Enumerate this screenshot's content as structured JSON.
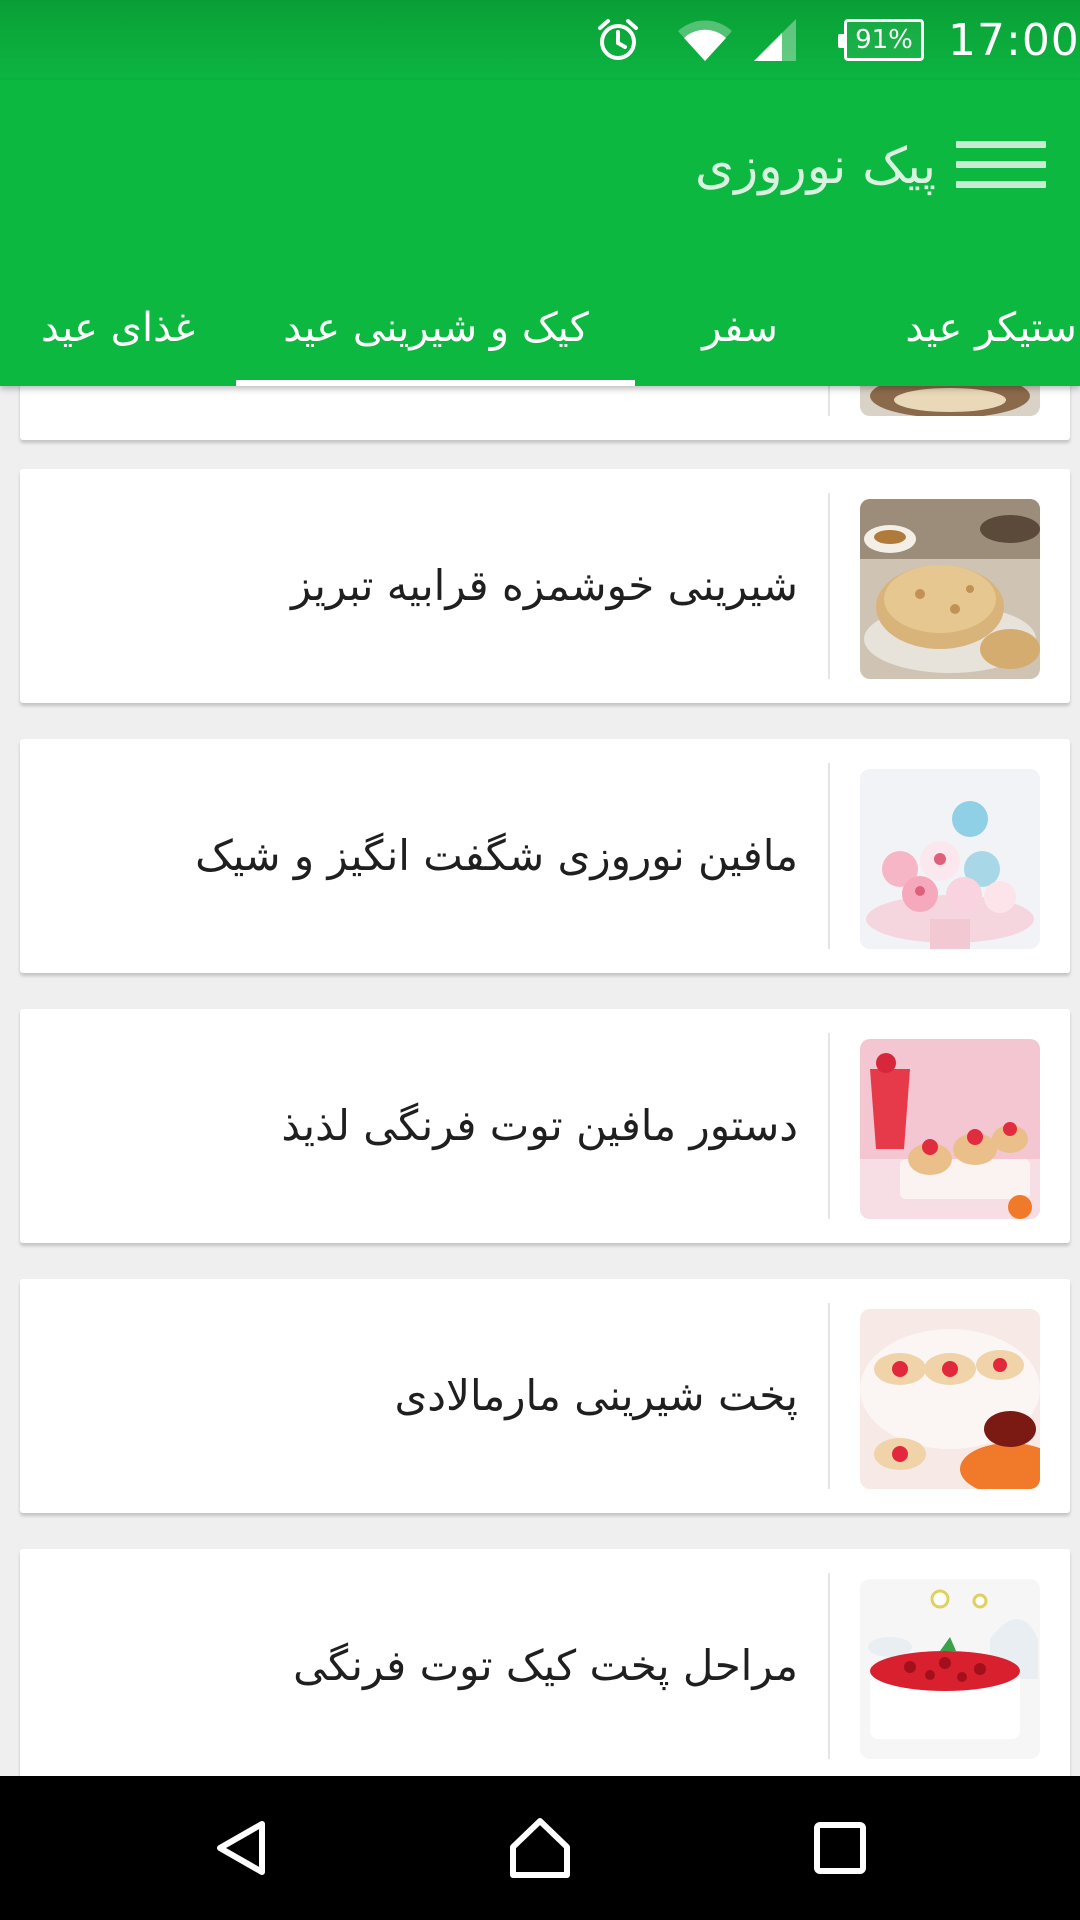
{
  "status": {
    "battery": "91%",
    "time": "17:00"
  },
  "app_bar": {
    "title": "پیک نوروزی"
  },
  "tabs": [
    {
      "label": "استیکر عید"
    },
    {
      "label": "سفر"
    },
    {
      "label": "کیک و شیرینی عید"
    },
    {
      "label": "غذای عید"
    }
  ],
  "selected_tab": "کیک و شیرینی عید",
  "recipes": [
    {
      "title": "شیرینی خوشمزه قرابیه تبریز",
      "image": "cookies-photo"
    },
    {
      "title": "مافین نوروزی شگفت انگیز و شیک",
      "image": "cupcakes-photo"
    },
    {
      "title": "دستور مافین توت فرنگی لذیذ",
      "image": "strawberry-muffins-photo"
    },
    {
      "title": "پخت شیرینی مارمالادی",
      "image": "jam-cookies-photo"
    },
    {
      "title": "مراحل پخت کیک توت فرنگی",
      "image": "strawberry-cake-photo"
    }
  ],
  "colors": {
    "primary": "#0cb840",
    "status_bar": "#0a9f36",
    "background": "#efefef"
  }
}
